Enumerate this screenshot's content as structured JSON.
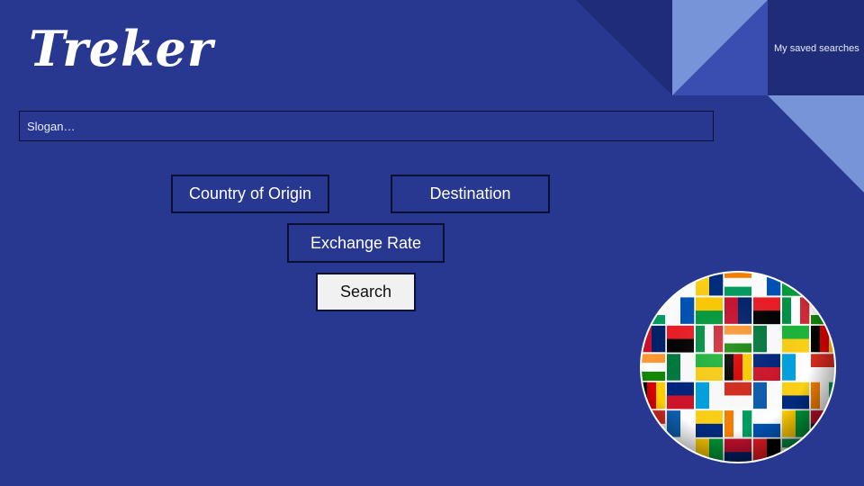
{
  "app": {
    "logo_text": "Treker"
  },
  "header": {
    "saved_searches_label": "My saved searches"
  },
  "slogan": {
    "placeholder": "Slogan…"
  },
  "form": {
    "origin_label": "Country of Origin",
    "destination_label": "Destination",
    "exchange_rate_label": "Exchange Rate",
    "search_label": "Search"
  },
  "decor": {
    "globe_icon": "flag-globe-icon"
  },
  "colors": {
    "background": "#283891",
    "accent_light": "#7a95d6",
    "accent_dark": "#1f2d7a",
    "search_button_bg": "#f1f1f1"
  }
}
